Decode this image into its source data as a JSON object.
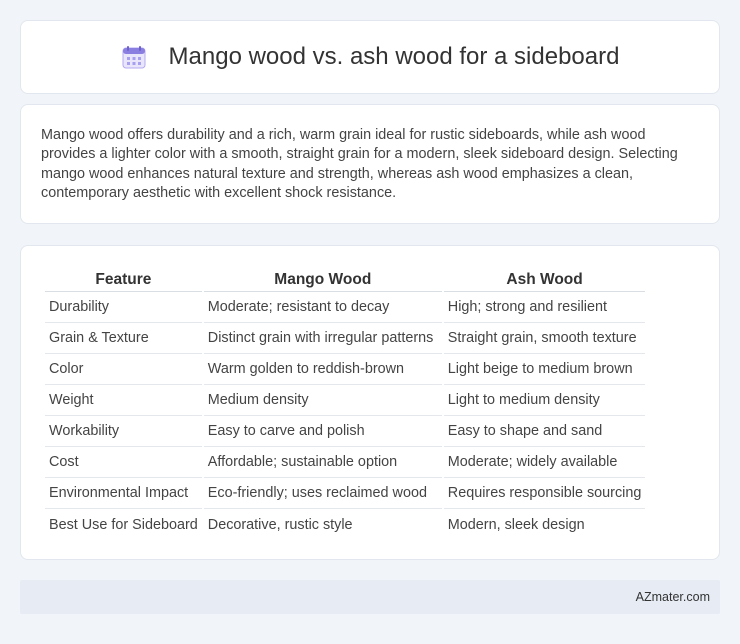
{
  "header": {
    "title": "Mango wood vs. ash wood for a sideboard",
    "icon": "calendar-icon"
  },
  "summary": {
    "text": "Mango wood offers durability and a rich, warm grain ideal for rustic sideboards, while ash wood provides a lighter color with a smooth, straight grain for a modern, sleek sideboard design. Selecting mango wood enhances natural texture and strength, whereas ash wood emphasizes a clean, contemporary aesthetic with excellent shock resistance."
  },
  "table": {
    "headers": [
      "Feature",
      "Mango Wood",
      "Ash Wood"
    ],
    "rows": [
      [
        "Durability",
        "Moderate; resistant to decay",
        "High; strong and resilient"
      ],
      [
        "Grain & Texture",
        "Distinct grain with irregular patterns",
        "Straight grain, smooth texture"
      ],
      [
        "Color",
        "Warm golden to reddish-brown",
        "Light beige to medium brown"
      ],
      [
        "Weight",
        "Medium density",
        "Light to medium density"
      ],
      [
        "Workability",
        "Easy to carve and polish",
        "Easy to shape and sand"
      ],
      [
        "Cost",
        "Affordable; sustainable option",
        "Moderate; widely available"
      ],
      [
        "Environmental Impact",
        "Eco-friendly; uses reclaimed wood",
        "Requires responsible sourcing"
      ],
      [
        "Best Use for Sideboard",
        "Decorative, rustic style",
        "Modern, sleek design"
      ]
    ]
  },
  "footer": {
    "brand": "AZmater.com"
  },
  "colors": {
    "background": "#f1f4f9",
    "card": "#ffffff",
    "footer": "#e6ebf4",
    "icon_accent": "#8a7fe0"
  }
}
